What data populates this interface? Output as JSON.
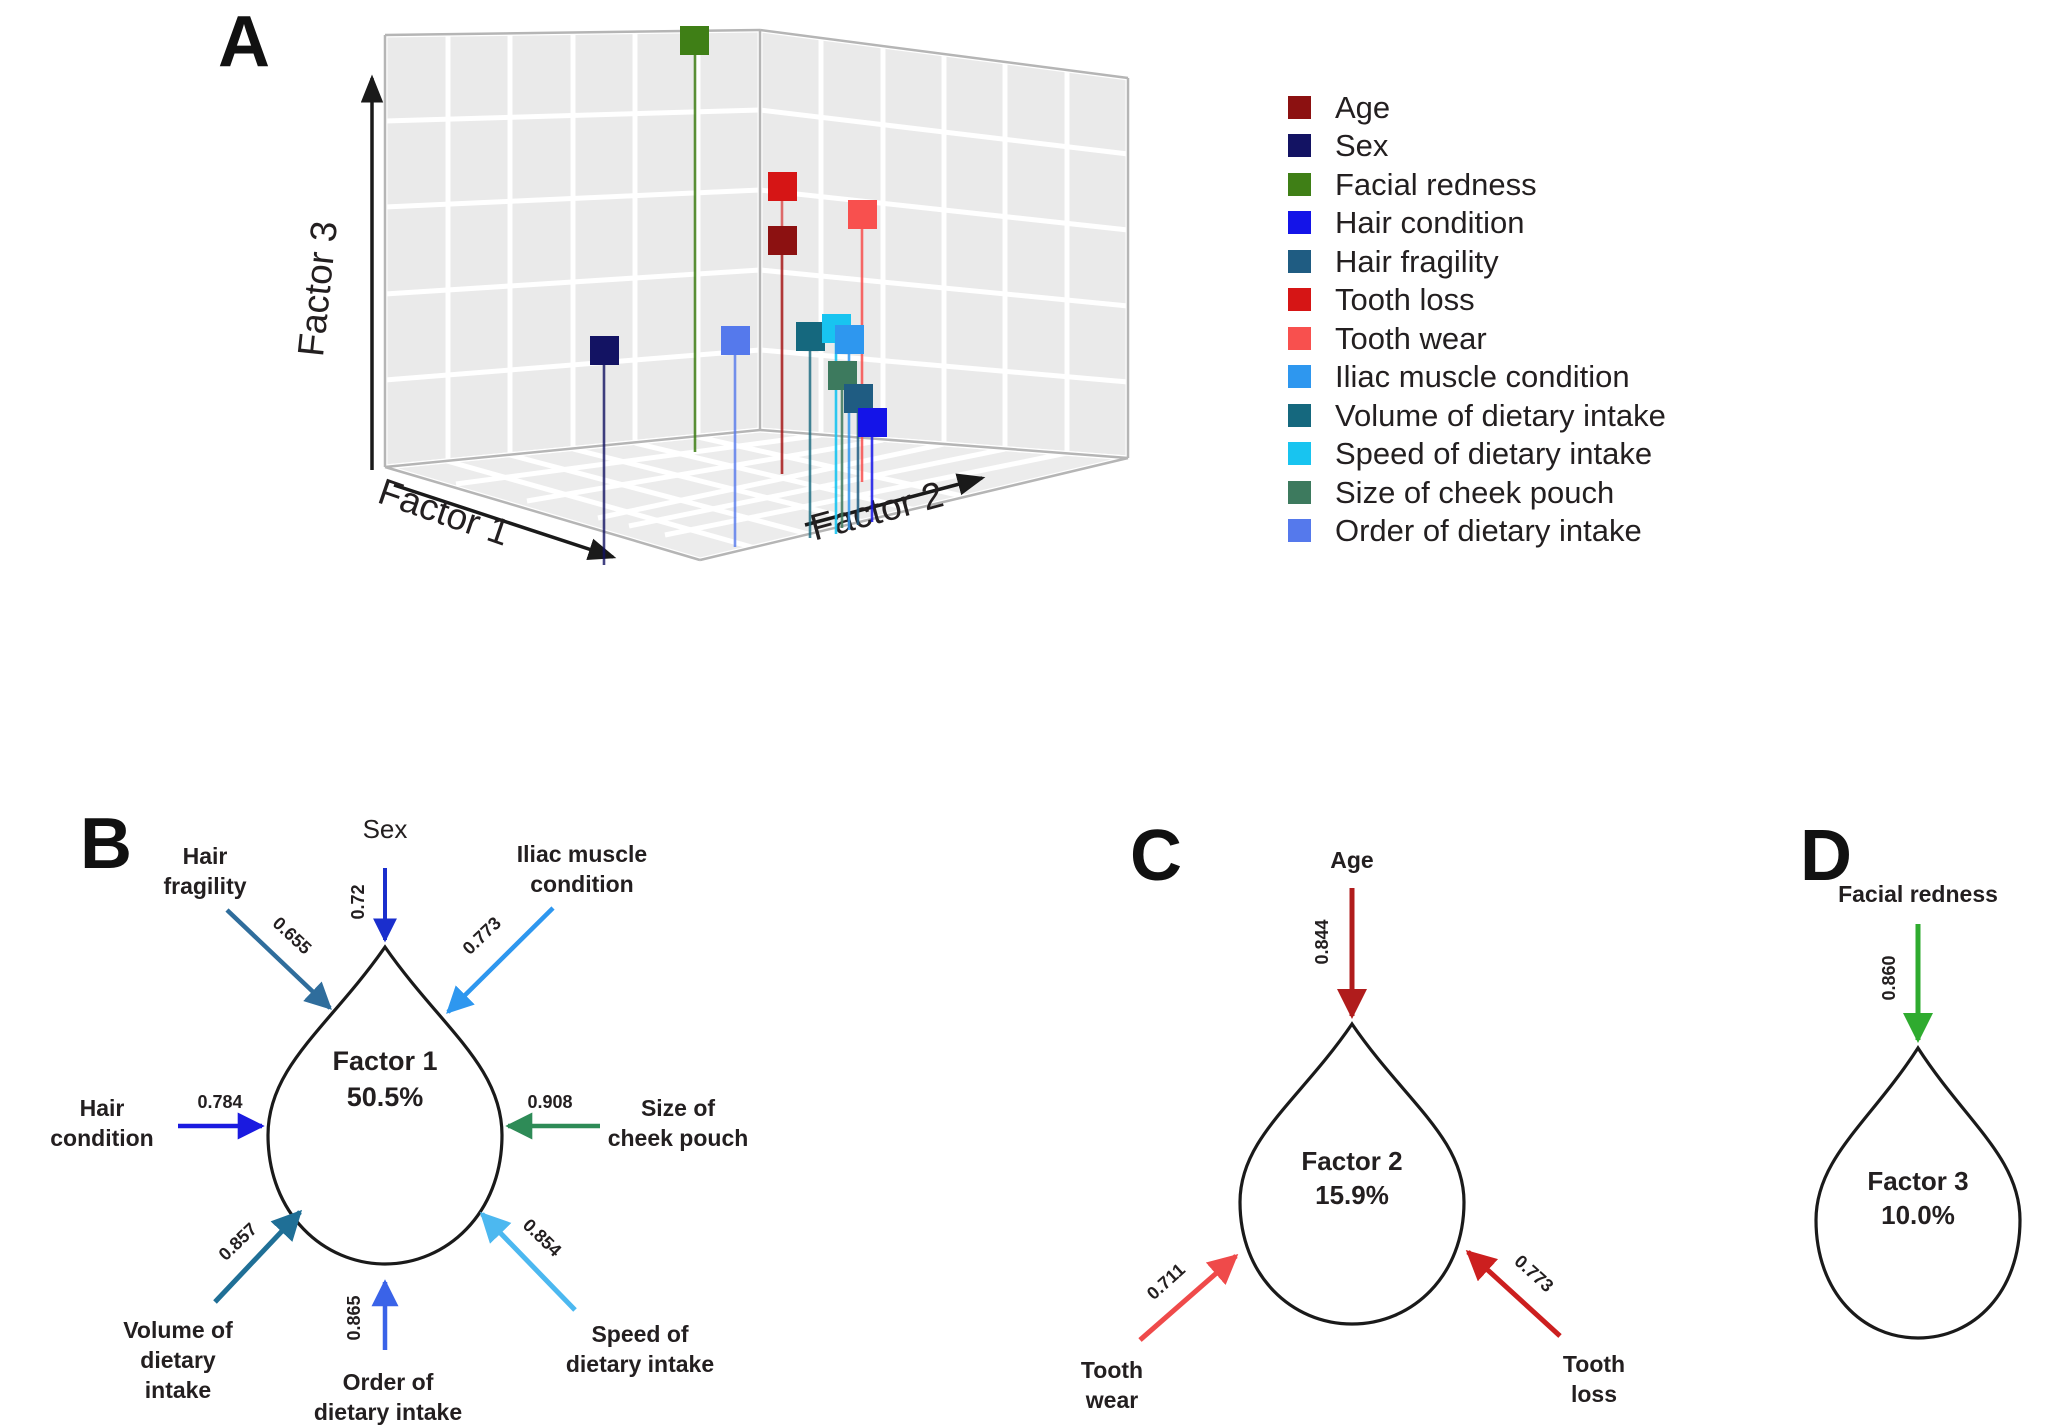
{
  "panels": {
    "a": {
      "letter": "A"
    },
    "b": {
      "letter": "B"
    },
    "c": {
      "letter": "C"
    },
    "d": {
      "letter": "D"
    }
  },
  "axes": {
    "x": "Factor 1",
    "y": "Factor 2",
    "z": "Factor 3"
  },
  "legend": {
    "items": [
      {
        "label": "Age",
        "color": "#8c1111"
      },
      {
        "label": "Sex",
        "color": "#131363"
      },
      {
        "label": "Facial redness",
        "color": "#3f7f16"
      },
      {
        "label": "Hair condition",
        "color": "#1414e8"
      },
      {
        "label": "Hair fragility",
        "color": "#1f5c82"
      },
      {
        "label": "Tooth loss",
        "color": "#d61515"
      },
      {
        "label": "Tooth wear",
        "color": "#f8504e"
      },
      {
        "label": "Iliac muscle condition",
        "color": "#2e97ef"
      },
      {
        "label": "Volume of dietary intake",
        "color": "#15687e"
      },
      {
        "label": "Speed of dietary intake",
        "color": "#18c4f0"
      },
      {
        "label": "Size of cheek pouch",
        "color": "#3d7a5e"
      },
      {
        "label": "Order of dietary intake",
        "color": "#5579ec"
      }
    ]
  },
  "chart_data": {
    "type": "scatter",
    "title": "",
    "xlabel": "Factor 1",
    "ylabel": "Factor 2",
    "zlabel": "Factor 3",
    "grid": true,
    "legend_position": "right",
    "note": "3D factor-loading stem plot; markers drop a stem to the Factor1-Factor2 floor plane.",
    "points": [
      {
        "name": "Age",
        "color": "#8c1111",
        "factor1": 0.21,
        "factor2": 0.844,
        "factor3": 0.13
      },
      {
        "name": "Sex",
        "color": "#131363",
        "factor1": 0.72,
        "factor2": 0.09,
        "factor3": 0.04
      },
      {
        "name": "Facial redness",
        "color": "#3f7f16",
        "factor1": 0.14,
        "factor2": 0.12,
        "factor3": 0.86
      },
      {
        "name": "Hair condition",
        "color": "#1414e8",
        "factor1": 0.784,
        "factor2": 0.18,
        "factor3": 0.06
      },
      {
        "name": "Hair fragility",
        "color": "#1f5c82",
        "factor1": 0.655,
        "factor2": 0.22,
        "factor3": 0.08
      },
      {
        "name": "Tooth loss",
        "color": "#d61515",
        "factor1": 0.26,
        "factor2": 0.773,
        "factor3": 0.23
      },
      {
        "name": "Tooth wear",
        "color": "#f8504e",
        "factor1": 0.3,
        "factor2": 0.711,
        "factor3": 0.19
      },
      {
        "name": "Iliac muscle condition",
        "color": "#2e97ef",
        "factor1": 0.773,
        "factor2": 0.24,
        "factor3": 0.1
      },
      {
        "name": "Volume of dietary intake",
        "color": "#15687e",
        "factor1": 0.857,
        "factor2": 0.15,
        "factor3": 0.07
      },
      {
        "name": "Speed of dietary intake",
        "color": "#18c4f0",
        "factor1": 0.854,
        "factor2": 0.21,
        "factor3": 0.11
      },
      {
        "name": "Size of cheek pouch",
        "color": "#3d7a5e",
        "factor1": 0.908,
        "factor2": 0.13,
        "factor3": 0.05
      },
      {
        "name": "Order of dietary intake",
        "color": "#5579ec",
        "factor1": 0.865,
        "factor2": 0.17,
        "factor3": 0.09
      }
    ]
  },
  "factor1": {
    "title": "Factor 1",
    "variance": "50.5%",
    "edges": [
      {
        "variable": "Sex",
        "weight": "0.72",
        "color": "#1a2ecd"
      },
      {
        "variable": "Hair fragility",
        "weight": "0.655",
        "color": "#2f6d9c"
      },
      {
        "variable": "Iliac muscle condition",
        "weight": "0.773",
        "color": "#2e97ef"
      },
      {
        "variable": "Hair condition",
        "weight": "0.784",
        "color": "#1a1ae0"
      },
      {
        "variable": "Size of cheek pouch",
        "weight": "0.908",
        "color": "#2e8b57"
      },
      {
        "variable": "Volume of dietary intake",
        "weight": "0.857",
        "color": "#1f6f96"
      },
      {
        "variable": "Speed of dietary intake",
        "weight": "0.854",
        "color": "#4cb8f0"
      },
      {
        "variable": "Order of dietary intake",
        "weight": "0.865",
        "color": "#3a63e8"
      }
    ]
  },
  "factor2": {
    "title": "Factor 2",
    "variance": "15.9%",
    "edges": [
      {
        "variable": "Age",
        "weight": "0.844",
        "color": "#b01c1c"
      },
      {
        "variable": "Tooth wear",
        "weight": "0.711",
        "color": "#ef4a4a"
      },
      {
        "variable": "Tooth loss",
        "weight": "0.773",
        "color": "#cc1f1f"
      }
    ]
  },
  "factor3": {
    "title": "Factor 3",
    "variance": "10.0%",
    "edges": [
      {
        "variable": "Facial redness",
        "weight": "0.860",
        "color": "#2fab2f"
      }
    ]
  },
  "labels": {
    "b": {
      "sex": "Sex",
      "hair_fragility_l1": "Hair",
      "hair_fragility_l2": "fragility",
      "iliac_l1": "Iliac muscle",
      "iliac_l2": "condition",
      "hair_condition_l1": "Hair",
      "hair_condition_l2": "condition",
      "cheek_l1": "Size of",
      "cheek_l2": "cheek pouch",
      "volume_l1": "Volume of",
      "volume_l2": "dietary",
      "volume_l3": "intake",
      "speed_l1": "Speed of",
      "speed_l2": "dietary intake",
      "order_l1": "Order of",
      "order_l2": "dietary intake"
    },
    "c": {
      "age": "Age",
      "tooth_wear_l1": "Tooth",
      "tooth_wear_l2": "wear",
      "tooth_loss_l1": "Tooth",
      "tooth_loss_l2": "loss"
    },
    "d": {
      "facial_redness": "Facial redness"
    }
  }
}
